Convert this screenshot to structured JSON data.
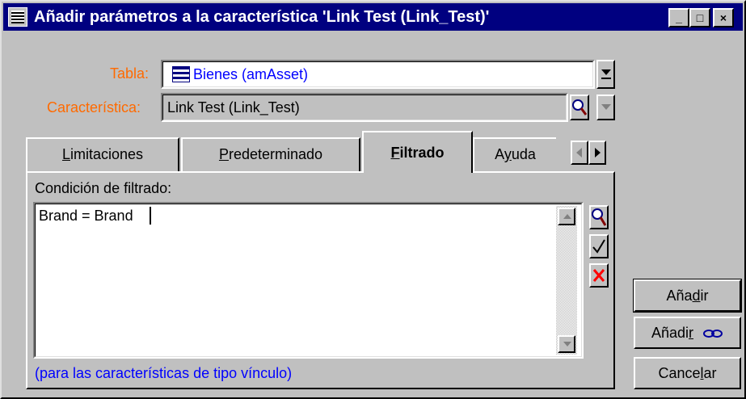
{
  "window": {
    "title": "Añadir parámetros a la característica 'Link Test (Link_Test)'",
    "controls": {
      "minimize": "_",
      "maximize": "□",
      "close": "×"
    }
  },
  "form": {
    "tabla_label": "Tabla:",
    "tabla_value": "Bienes (amAsset)",
    "caracteristica_label": "Característica:",
    "caracteristica_value": "Link Test (Link_Test)"
  },
  "tabs": [
    {
      "label_pre": "",
      "label_ul": "L",
      "label_post": "imitaciones",
      "active": false
    },
    {
      "label_pre": "",
      "label_ul": "P",
      "label_post": "redeterminado",
      "active": false
    },
    {
      "label_pre": "",
      "label_ul": "F",
      "label_post": "iltrado",
      "active": true
    },
    {
      "label_pre": "A",
      "label_ul": "y",
      "label_post": "uda",
      "active": false
    }
  ],
  "filter": {
    "condition_label": "Condición de filtrado:",
    "condition_value": "Brand = Brand",
    "note": "(para las características de tipo vínculo)"
  },
  "buttons": {
    "add": {
      "pre": "Aña",
      "ul": "d",
      "post": "ir"
    },
    "add_more": {
      "pre": "Añadi",
      "ul": "r",
      "post": ""
    },
    "cancel": {
      "pre": "Cance",
      "ul": "l",
      "post": "ar"
    }
  },
  "colors": {
    "titlebar": "#000080",
    "label_orange": "#ff6a00",
    "blue_text": "#0000ff",
    "face": "#c0c0c0"
  },
  "icons": [
    "table-icon",
    "magnifier-icon",
    "check-icon",
    "delete-x-icon",
    "chain-link-icon",
    "arrow-left-icon",
    "arrow-right-icon",
    "dropdown-arrow-icon"
  ]
}
